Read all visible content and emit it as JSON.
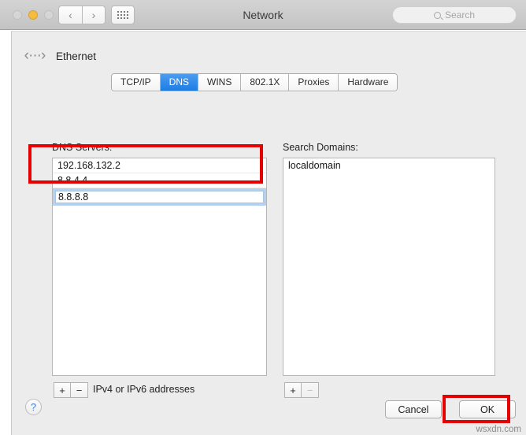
{
  "window": {
    "title": "Network",
    "traffic_lights": [
      "close-inactive",
      "minimize-amber",
      "zoom-inactive"
    ],
    "back_glyph": "‹",
    "forward_glyph": "›",
    "grid_icon": "grid-icon",
    "search": {
      "placeholder": "Search",
      "icon": "search-icon"
    }
  },
  "interface": {
    "icon": "ethernet-icon",
    "icon_glyph": "‹···›",
    "name": "Ethernet"
  },
  "tabs": [
    {
      "label": "TCP/IP",
      "active": false
    },
    {
      "label": "DNS",
      "active": true
    },
    {
      "label": "WINS",
      "active": false
    },
    {
      "label": "802.1X",
      "active": false
    },
    {
      "label": "Proxies",
      "active": false
    },
    {
      "label": "Hardware",
      "active": false
    }
  ],
  "dns_panel": {
    "label": "DNS Servers:",
    "entries": [
      {
        "value": "192.168.132.2",
        "selected": false
      },
      {
        "value": "8.8.4.4",
        "selected": false
      },
      {
        "value": "8.8.8.8",
        "selected": true
      }
    ],
    "add_label": "+",
    "remove_label": "−",
    "hint": "IPv4 or IPv6 addresses"
  },
  "search_panel": {
    "label": "Search Domains:",
    "entries": [
      {
        "value": "localdomain",
        "selected": false
      }
    ],
    "add_label": "+",
    "remove_label": "−",
    "remove_disabled": true
  },
  "footer": {
    "help_label": "?",
    "cancel_label": "Cancel",
    "ok_label": "OK"
  },
  "annotations": {
    "color": "#e60000",
    "targets": [
      "dns-entries-highlight",
      "ok-button-highlight"
    ]
  },
  "watermark": "wsxdn.com"
}
